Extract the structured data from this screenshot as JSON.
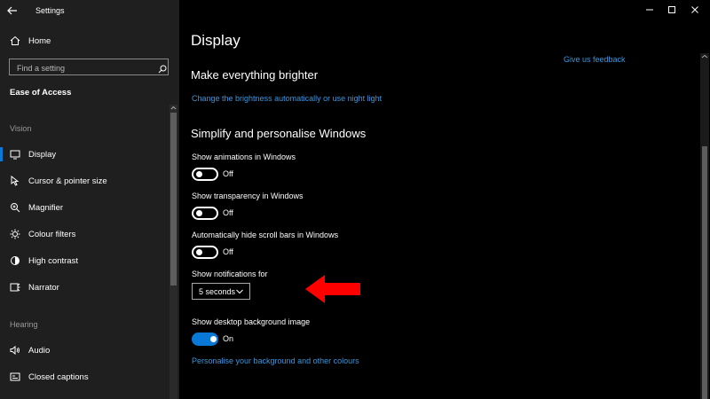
{
  "window": {
    "title": "Settings"
  },
  "sidebar": {
    "home_label": "Home",
    "search_placeholder": "Find a setting",
    "section_title": "Ease of Access",
    "groups": {
      "vision": "Vision",
      "hearing": "Hearing"
    },
    "items": [
      {
        "label": "Display",
        "icon": "monitor-icon",
        "selected": true
      },
      {
        "label": "Cursor & pointer size",
        "icon": "cursor-icon"
      },
      {
        "label": "Magnifier",
        "icon": "magnifier-icon"
      },
      {
        "label": "Colour filters",
        "icon": "colour-filters-icon"
      },
      {
        "label": "High contrast",
        "icon": "high-contrast-icon"
      },
      {
        "label": "Narrator",
        "icon": "narrator-icon"
      },
      {
        "label": "Audio",
        "icon": "speaker-icon"
      },
      {
        "label": "Closed captions",
        "icon": "captions-icon"
      }
    ]
  },
  "main": {
    "page_title": "Display",
    "feedback_link": "Give us feedback",
    "brighter": {
      "heading": "Make everything brighter",
      "link": "Change the brightness automatically or use night light"
    },
    "simplify": {
      "heading": "Simplify and personalise Windows",
      "animations": {
        "label": "Show animations in Windows",
        "state": "Off"
      },
      "transparency": {
        "label": "Show transparency in Windows",
        "state": "Off"
      },
      "scrollbars": {
        "label": "Automatically hide scroll bars in Windows",
        "state": "Off"
      },
      "notifications": {
        "label": "Show notifications for",
        "value": "5 seconds"
      },
      "background": {
        "label": "Show desktop background image",
        "state": "On"
      },
      "personalise_link": "Personalise your background and other colours"
    }
  },
  "colors": {
    "accent": "#0a78d7",
    "link": "#3a96dd",
    "annotation_arrow": "#ff0000"
  }
}
